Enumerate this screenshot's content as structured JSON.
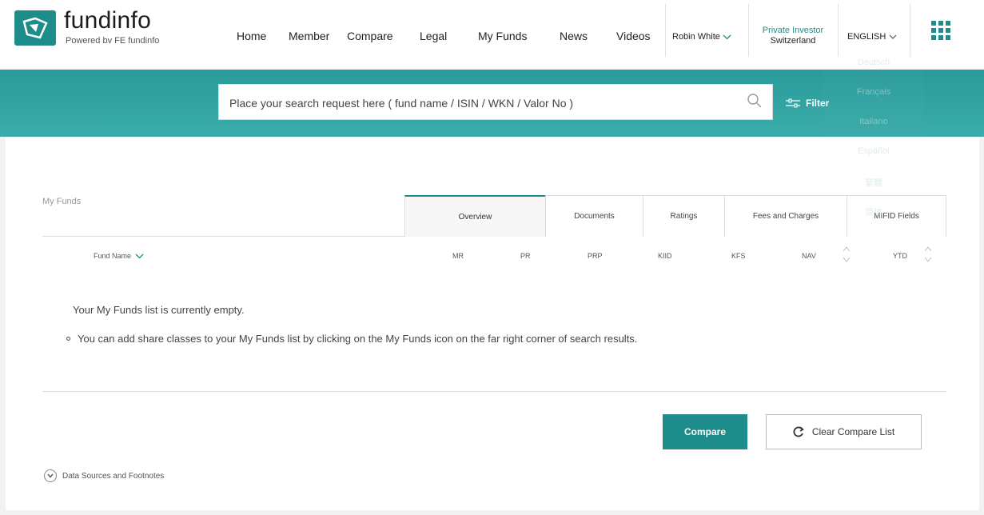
{
  "brand": {
    "name": "fundinfo",
    "tagline": "Powered bv FE fundinfo"
  },
  "nav": {
    "items": [
      {
        "label": "Home"
      },
      {
        "label": "Member"
      },
      {
        "label": "Compare"
      },
      {
        "label": "Legal"
      },
      {
        "label": "My Funds"
      },
      {
        "label": "News"
      },
      {
        "label": "Videos"
      }
    ],
    "user": "Robin White",
    "investor_type": "Private Investor",
    "country": "Switzerland",
    "language": "ENGLISH"
  },
  "language_options": [
    "Deutsch",
    "Français",
    "Italiano",
    "Español",
    "繁體",
    "简体"
  ],
  "search": {
    "placeholder": "Place your search request here ( fund name / ISIN / WKN / Valor No )",
    "filter_label": "Filter"
  },
  "section": {
    "title": "My Funds"
  },
  "tabs": [
    {
      "label": "Overview",
      "active": true
    },
    {
      "label": "Documents",
      "active": false
    },
    {
      "label": "Ratings",
      "active": false
    },
    {
      "label": "Fees and Charges",
      "active": false
    },
    {
      "label": "MIFID Fields",
      "active": false
    }
  ],
  "columns": {
    "fund_name": "Fund Name",
    "mr": "MR",
    "pr": "PR",
    "prp": "PRP",
    "kiid": "KIID",
    "kfs": "KFS",
    "nav": "NAV",
    "ytd": "YTD"
  },
  "empty_state": {
    "message": "Your My Funds list is currently empty.",
    "hint": "You can add share classes to your My Funds list by clicking on the My Funds icon on the far right corner of search results."
  },
  "actions": {
    "compare": "Compare",
    "clear_compare": "Clear Compare List"
  },
  "footnotes_label": "Data Sources and Footnotes",
  "colors": {
    "accent": "#1f8c8c",
    "band": "#2a9b9a"
  }
}
